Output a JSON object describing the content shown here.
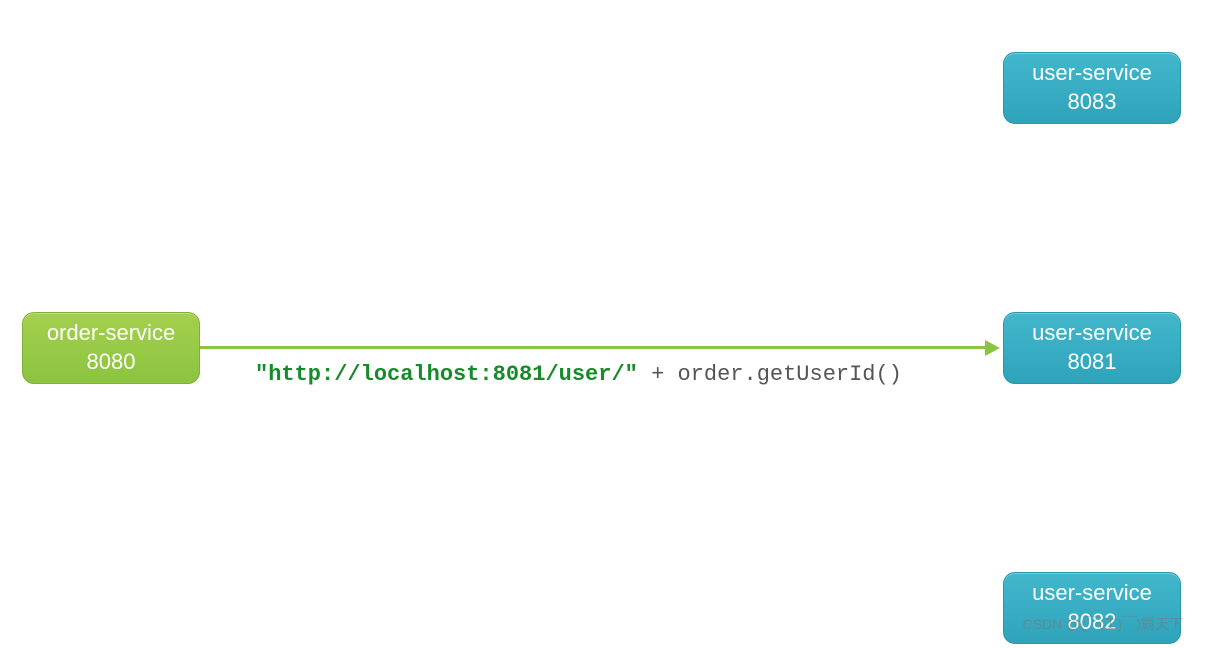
{
  "nodes": {
    "order_service": {
      "name": "order-service",
      "port": "8080"
    },
    "user_service_1": {
      "name": "user-service",
      "port": "8083"
    },
    "user_service_2": {
      "name": "user-service",
      "port": "8081"
    },
    "user_service_3": {
      "name": "user-service",
      "port": "8082"
    }
  },
  "connection": {
    "code_string": "\"http://localhost:8081/user/\"",
    "code_rest": " + order.getUserId()"
  },
  "watermark": "CSDN @(￣(工)￣)霸天下"
}
